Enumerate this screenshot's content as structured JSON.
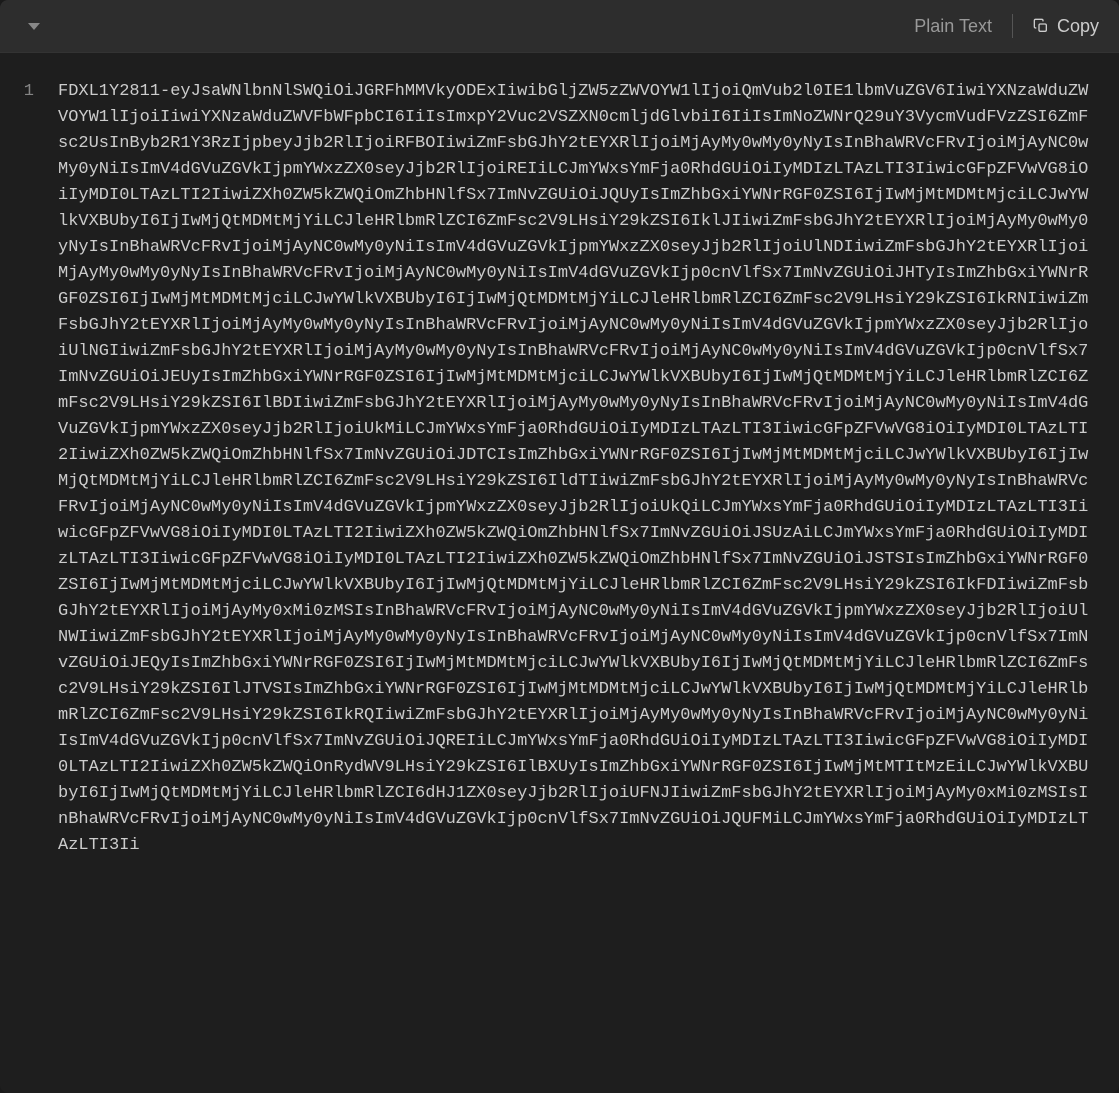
{
  "header": {
    "language_label": "Plain Text",
    "copy_label": "Copy"
  },
  "code": {
    "line_number": "1",
    "content": "FDXL1Y2811-eyJsaWNlbnNlSWQiOiJGRFhMMVkyODExIiwibGljZW5zZWVOYW1lIjoiQmVub2l0IE1lbmVuZGV6IiwiYXNzaWduZWVOYW1lIjoiIiwiYXNzaWduZWVFbWFpbCI6IiIsImxpY2Vuc2VSZXN0cmljdGlvbiI6IiIsImNoZWNrQ29uY3VycmVudFVzZSI6ZmFsc2UsInByb2R1Y3RzIjpbeyJjb2RlIjoiRFBOIiwiZmFsbGJhY2tEYXRlIjoiMjAyMy0wMy0yNyIsInBhaWRVcFRvIjoiMjAyNC0wMy0yNiIsImV4dGVuZGVkIjpmYWxzZX0seyJjb2RlIjoiREIiLCJmYWxsYmFja0RhdGUiOiIyMDIzLTAzLTI3IiwicGFpZFVwVG8iOiIyMDI0LTAzLTI2IiwiZXh0ZW5kZWQiOmZhbHNlfSx7ImNvZGUiOiJQUyIsImZhbGxiYWNrRGF0ZSI6IjIwMjMtMDMtMjciLCJwYWlkVXBUbyI6IjIwMjQtMDMtMjYiLCJleHRlbmRlZCI6ZmFsc2V9LHsiY29kZSI6IklJIiwiZmFsbGJhY2tEYXRlIjoiMjAyMy0wMy0yNyIsInBhaWRVcFRvIjoiMjAyNC0wMy0yNiIsImV4dGVuZGVkIjpmYWxzZX0seyJjb2RlIjoiUlNDIiwiZmFsbGJhY2tEYXRlIjoiMjAyMy0wMy0yNyIsInBhaWRVcFRvIjoiMjAyNC0wMy0yNiIsImV4dGVuZGVkIjp0cnVlfSx7ImNvZGUiOiJHTyIsImZhbGxiYWNrRGF0ZSI6IjIwMjMtMDMtMjciLCJwYWlkVXBUbyI6IjIwMjQtMDMtMjYiLCJleHRlbmRlZCI6ZmFsc2V9LHsiY29kZSI6IkRNIiwiZmFsbGJhY2tEYXRlIjoiMjAyMy0wMy0yNyIsInBhaWRVcFRvIjoiMjAyNC0wMy0yNiIsImV4dGVuZGVkIjpmYWxzZX0seyJjb2RlIjoiUlNGIiwiZmFsbGJhY2tEYXRlIjoiMjAyMy0wMy0yNyIsInBhaWRVcFRvIjoiMjAyNC0wMy0yNiIsImV4dGVuZGVkIjp0cnVlfSx7ImNvZGUiOiJEUyIsImZhbGxiYWNrRGF0ZSI6IjIwMjMtMDMtMjciLCJwYWlkVXBUbyI6IjIwMjQtMDMtMjYiLCJleHRlbmRlZCI6ZmFsc2V9LHsiY29kZSI6IlBDIiwiZmFsbGJhY2tEYXRlIjoiMjAyMy0wMy0yNyIsInBhaWRVcFRvIjoiMjAyNC0wMy0yNiIsImV4dGVuZGVkIjpmYWxzZX0seyJjb2RlIjoiUkMiLCJmYWxsYmFja0RhdGUiOiIyMDIzLTAzLTI3IiwicGFpZFVwVG8iOiIyMDI0LTAzLTI2IiwiZXh0ZW5kZWQiOmZhbHNlfSx7ImNvZGUiOiJDTCIsImZhbGxiYWNrRGF0ZSI6IjIwMjMtMDMtMjciLCJwYWlkVXBUbyI6IjIwMjQtMDMtMjYiLCJleHRlbmRlZCI6ZmFsc2V9LHsiY29kZSI6IldTIiwiZmFsbGJhY2tEYXRlIjoiMjAyMy0wMy0yNyIsInBhaWRVcFRvIjoiMjAyNC0wMy0yNiIsImV4dGVuZGVkIjpmYWxzZX0seyJjb2RlIjoiUkQiLCJmYWxsYmFja0RhdGUiOiIyMDIzLTAzLTI3IiwicGFpZFVwVG8iOiIyMDI0LTAzLTI2IiwiZXh0ZW5kZWQiOmZhbHNlfSx7ImNvZGUiOiJSUzAiLCJmYWxsYmFja0RhdGUiOiIyMDIzLTAzLTI3IiwicGFpZFVwVG8iOiIyMDI0LTAzLTI2IiwiZXh0ZW5kZWQiOmZhbHNlfSx7ImNvZGUiOiJSTSIsImZhbGxiYWNrRGF0ZSI6IjIwMjMtMDMtMjciLCJwYWlkVXBUbyI6IjIwMjQtMDMtMjYiLCJleHRlbmRlZCI6ZmFsc2V9LHsiY29kZSI6IkFDIiwiZmFsbGJhY2tEYXRlIjoiMjAyMy0xMi0zMSIsInBhaWRVcFRvIjoiMjAyNC0wMy0yNiIsImV4dGVuZGVkIjpmYWxzZX0seyJjb2RlIjoiUlNWIiwiZmFsbGJhY2tEYXRlIjoiMjAyMy0wMy0yNyIsInBhaWRVcFRvIjoiMjAyNC0wMy0yNiIsImV4dGVuZGVkIjp0cnVlfSx7ImNvZGUiOiJEQyIsImZhbGxiYWNrRGF0ZSI6IjIwMjMtMDMtMjciLCJwYWlkVXBUbyI6IjIwMjQtMDMtMjYiLCJleHRlbmRlZCI6ZmFsc2V9LHsiY29kZSI6IlJTVSIsImZhbGxiYWNrRGF0ZSI6IjIwMjMtMDMtMjciLCJwYWlkVXBUbyI6IjIwMjQtMDMtMjYiLCJleHRlbmRlZCI6ZmFsc2V9LHsiY29kZSI6IkRQIiwiZmFsbGJhY2tEYXRlIjoiMjAyMy0wMy0yNyIsInBhaWRVcFRvIjoiMjAyNC0wMy0yNiIsImV4dGVuZGVkIjp0cnVlfSx7ImNvZGUiOiJQREIiLCJmYWxsYmFja0RhdGUiOiIyMDIzLTAzLTI3IiwicGFpZFVwVG8iOiIyMDI0LTAzLTI2IiwiZXh0ZW5kZWQiOnRydWV9LHsiY29kZSI6IlBXUyIsImZhbGxiYWNrRGF0ZSI6IjIwMjMtMTItMzEiLCJwYWlkVXBUbyI6IjIwMjQtMDMtMjYiLCJleHRlbmRlZCI6dHJ1ZX0seyJjb2RlIjoiUFNJIiwiZmFsbGJhY2tEYXRlIjoiMjAyMy0xMi0zMSIsInBhaWRVcFRvIjoiMjAyNC0wMy0yNiIsImV4dGVuZGVkIjp0cnVlfSx7ImNvZGUiOiJQUFMiLCJmYWxsYmFja0RhdGUiOiIyMDIzLTAzLTI3Ii"
  }
}
